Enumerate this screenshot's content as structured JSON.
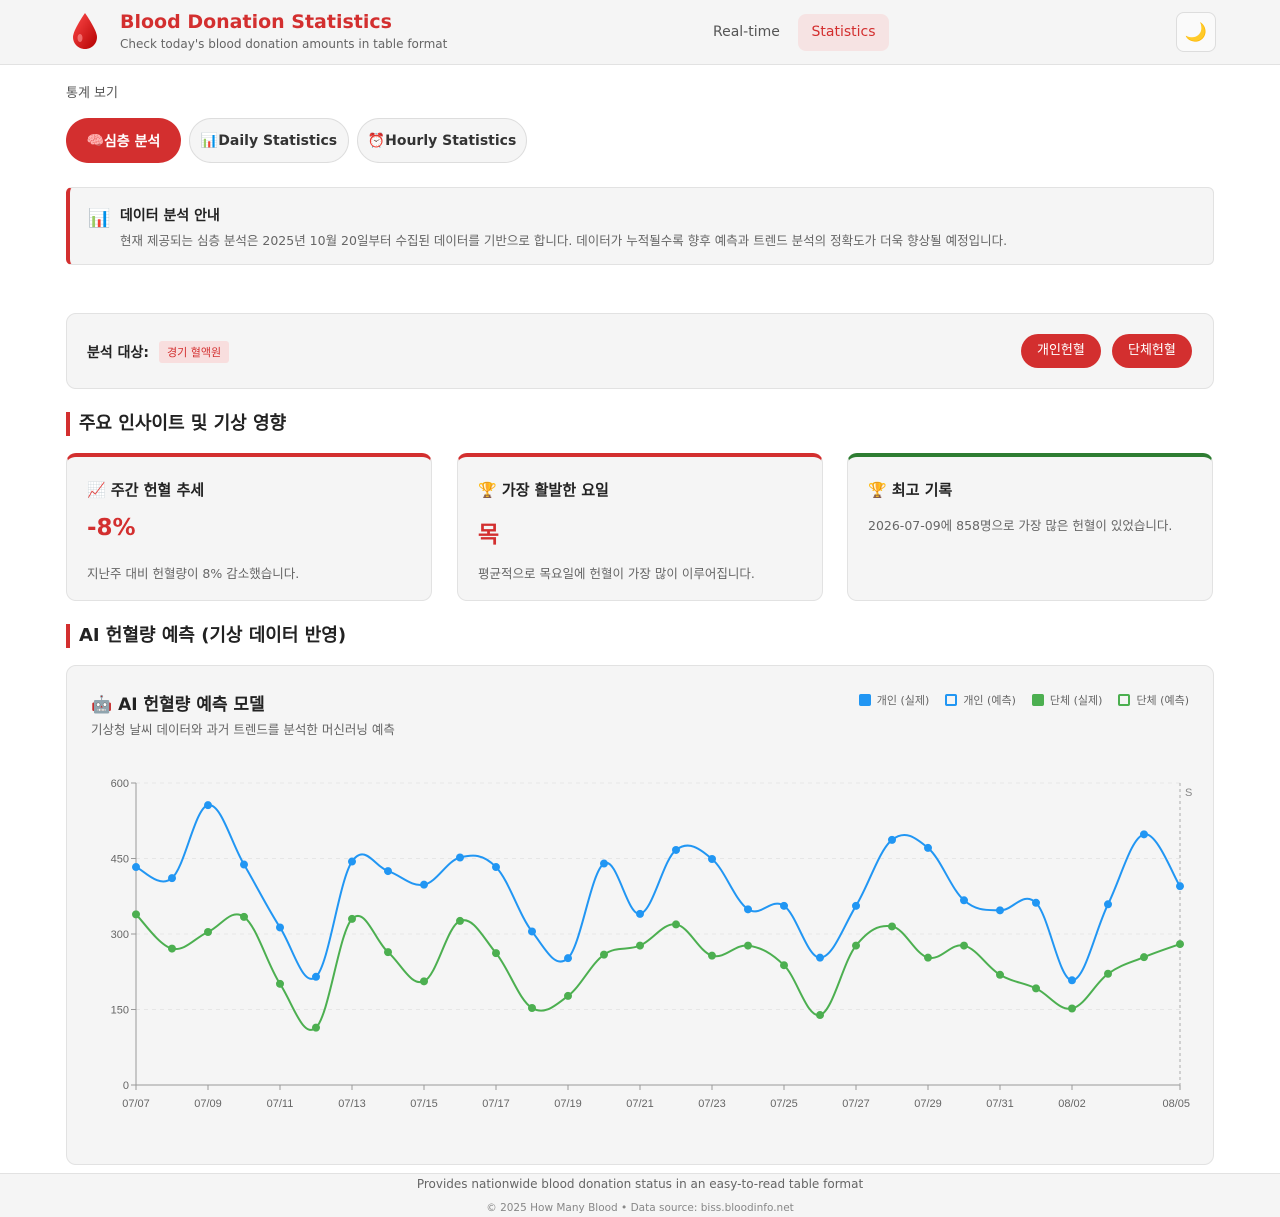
{
  "header": {
    "title": "Blood Donation Statistics",
    "subtitle": "Check today's blood donation amounts in table format",
    "nav": {
      "realtime": "Real-time",
      "statistics": "Statistics"
    },
    "theme_icon": "moon-icon",
    "theme_glyph": "🌙",
    "brand_color": "#d32f2f"
  },
  "section_label": "통계 보기",
  "tabs": [
    {
      "icon": "🧠",
      "label": "심층 분석",
      "active": true
    },
    {
      "icon": "📊",
      "label": "Daily Statistics",
      "active": false
    },
    {
      "icon": "⏰",
      "label": "Hourly Statistics",
      "active": false
    }
  ],
  "info": {
    "icon": "📊",
    "title": "데이터 분석 안내",
    "text": "현재 제공되는 심층 분석은 2025년 10월 20일부터 수집된 데이터를 기반으로 합니다. 데이터가 누적될수록 향후 예측과 트렌드 분석의 정확도가 더욱 향상될 예정입니다."
  },
  "target": {
    "label": "분석 대상:",
    "region": "경기 혈액원",
    "buttons": {
      "individual": "개인헌혈",
      "group": "단체헌혈"
    }
  },
  "insights": {
    "heading": "주요 인사이트 및 기상 영향",
    "cards": [
      {
        "icon": "📈",
        "title": "주간 헌혈 추세",
        "value": "-8%",
        "desc": "지난주 대비 헌혈량이 8% 감소했습니다."
      },
      {
        "icon": "🏆",
        "title": "가장 활발한 요일",
        "value": "목",
        "desc": "평균적으로 목요일에 헌혈이 가장 많이 이루어집니다."
      },
      {
        "icon": "🏆",
        "title": "최고 기록",
        "value": "",
        "desc": "2026-07-09에 858명으로 가장 많은 헌혈이 있었습니다."
      }
    ]
  },
  "ai": {
    "heading": "AI 헌혈량 예측 (기상 데이터 반영)",
    "chart_title_icon": "🤖",
    "chart_title": "AI 헌혈량 예측 모델",
    "chart_subtitle": "기상청 날씨 데이터와 과거 트렌드를 분석한 머신러닝 예측",
    "legend": [
      {
        "label": "개인 (실제)",
        "color": "#2196f3",
        "filled": true
      },
      {
        "label": "개인 (예측)",
        "color": "#2196f3",
        "filled": false
      },
      {
        "label": "단체 (실제)",
        "color": "#4caf50",
        "filled": true
      },
      {
        "label": "단체 (예측)",
        "color": "#4caf50",
        "filled": false
      }
    ]
  },
  "chart_data": {
    "type": "line",
    "x": [
      "07/07",
      "07/08",
      "07/09",
      "07/10",
      "07/11",
      "07/12",
      "07/13",
      "07/14",
      "07/15",
      "07/16",
      "07/17",
      "07/18",
      "07/19",
      "07/20",
      "07/21",
      "07/22",
      "07/23",
      "07/24",
      "07/25",
      "07/26",
      "07/27",
      "07/28",
      "07/29",
      "07/30",
      "07/31",
      "08/01",
      "08/02",
      "08/03",
      "08/04",
      "08/05"
    ],
    "x_tick_labels": [
      "07/07",
      "07/09",
      "07/11",
      "07/13",
      "07/15",
      "07/17",
      "07/19",
      "07/21",
      "07/23",
      "07/25",
      "07/27",
      "07/29",
      "07/31",
      "08/02",
      "08/05"
    ],
    "series": [
      {
        "name": "개인 (실제)",
        "color": "#2196f3",
        "values": [
          433,
          411,
          556,
          438,
          313,
          215,
          444,
          425,
          398,
          452,
          433,
          305,
          252,
          440,
          340,
          467,
          449,
          349,
          356,
          253,
          356,
          487,
          471,
          367,
          347,
          362,
          208,
          359,
          498,
          395
        ]
      },
      {
        "name": "단체 (실제)",
        "color": "#4caf50",
        "values": [
          339,
          271,
          304,
          334,
          201,
          114,
          330,
          264,
          206,
          326,
          262,
          153,
          177,
          259,
          277,
          319,
          257,
          277,
          238,
          139,
          277,
          315,
          253,
          277,
          219,
          192,
          152,
          221,
          254,
          280
        ]
      }
    ],
    "ylim": [
      0,
      600
    ],
    "yticks": [
      0,
      150,
      300,
      450,
      600
    ],
    "marker_text": "S",
    "grid": true,
    "legend_position": "top-right"
  },
  "footer": {
    "line1": "Provides nationwide blood donation status in an easy-to-read table format",
    "line2": "© 2025 How Many Blood   •   Data source: biss.bloodinfo.net"
  }
}
